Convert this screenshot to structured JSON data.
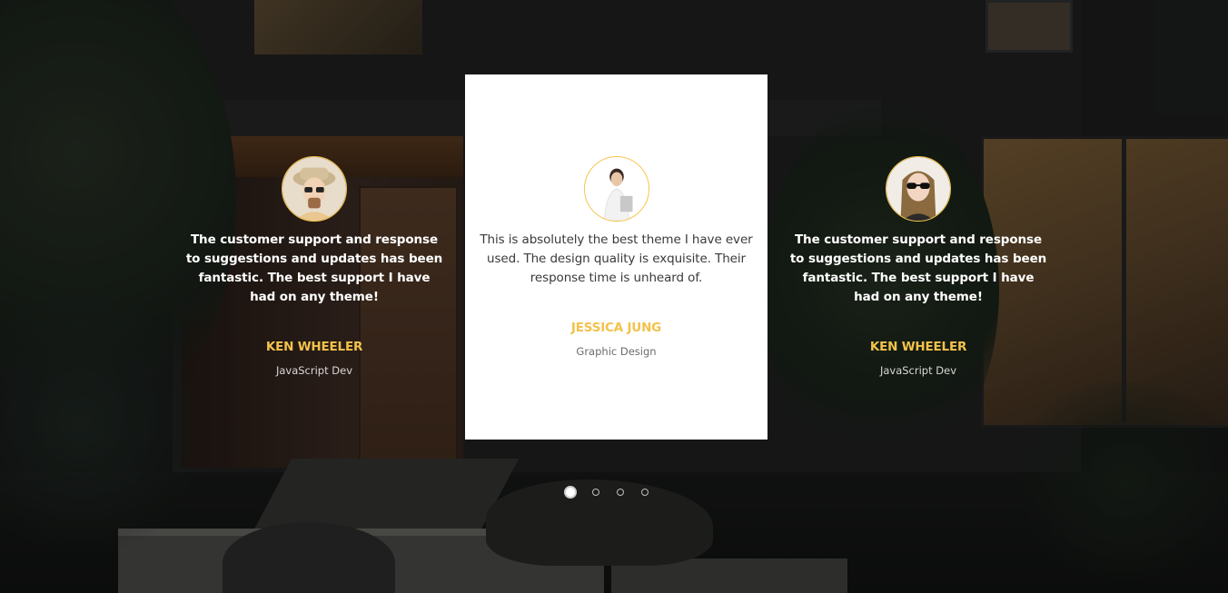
{
  "testimonials": {
    "left": {
      "quote": "The customer support and response to suggestions and updates has been fantastic. The best support I have had on any theme!",
      "name": "KEN WHEELER",
      "role": "JavaScript Dev"
    },
    "active": {
      "quote": "This is absolutely the best theme I have ever used. The design quality is exquisite. Their response time is unheard of.",
      "name": "JESSICA JUNG",
      "role": "Graphic Design"
    },
    "right": {
      "quote": "The customer support and response to suggestions and updates has been fantastic. The best support I have had on any theme!",
      "name": "KEN WHEELER",
      "role": "JavaScript Dev"
    }
  },
  "pagination": {
    "count": 4,
    "active_index": 0
  },
  "colors": {
    "accent": "#f3c24b",
    "card_bg": "#ffffff",
    "quote_active": "#3a3a3a"
  }
}
